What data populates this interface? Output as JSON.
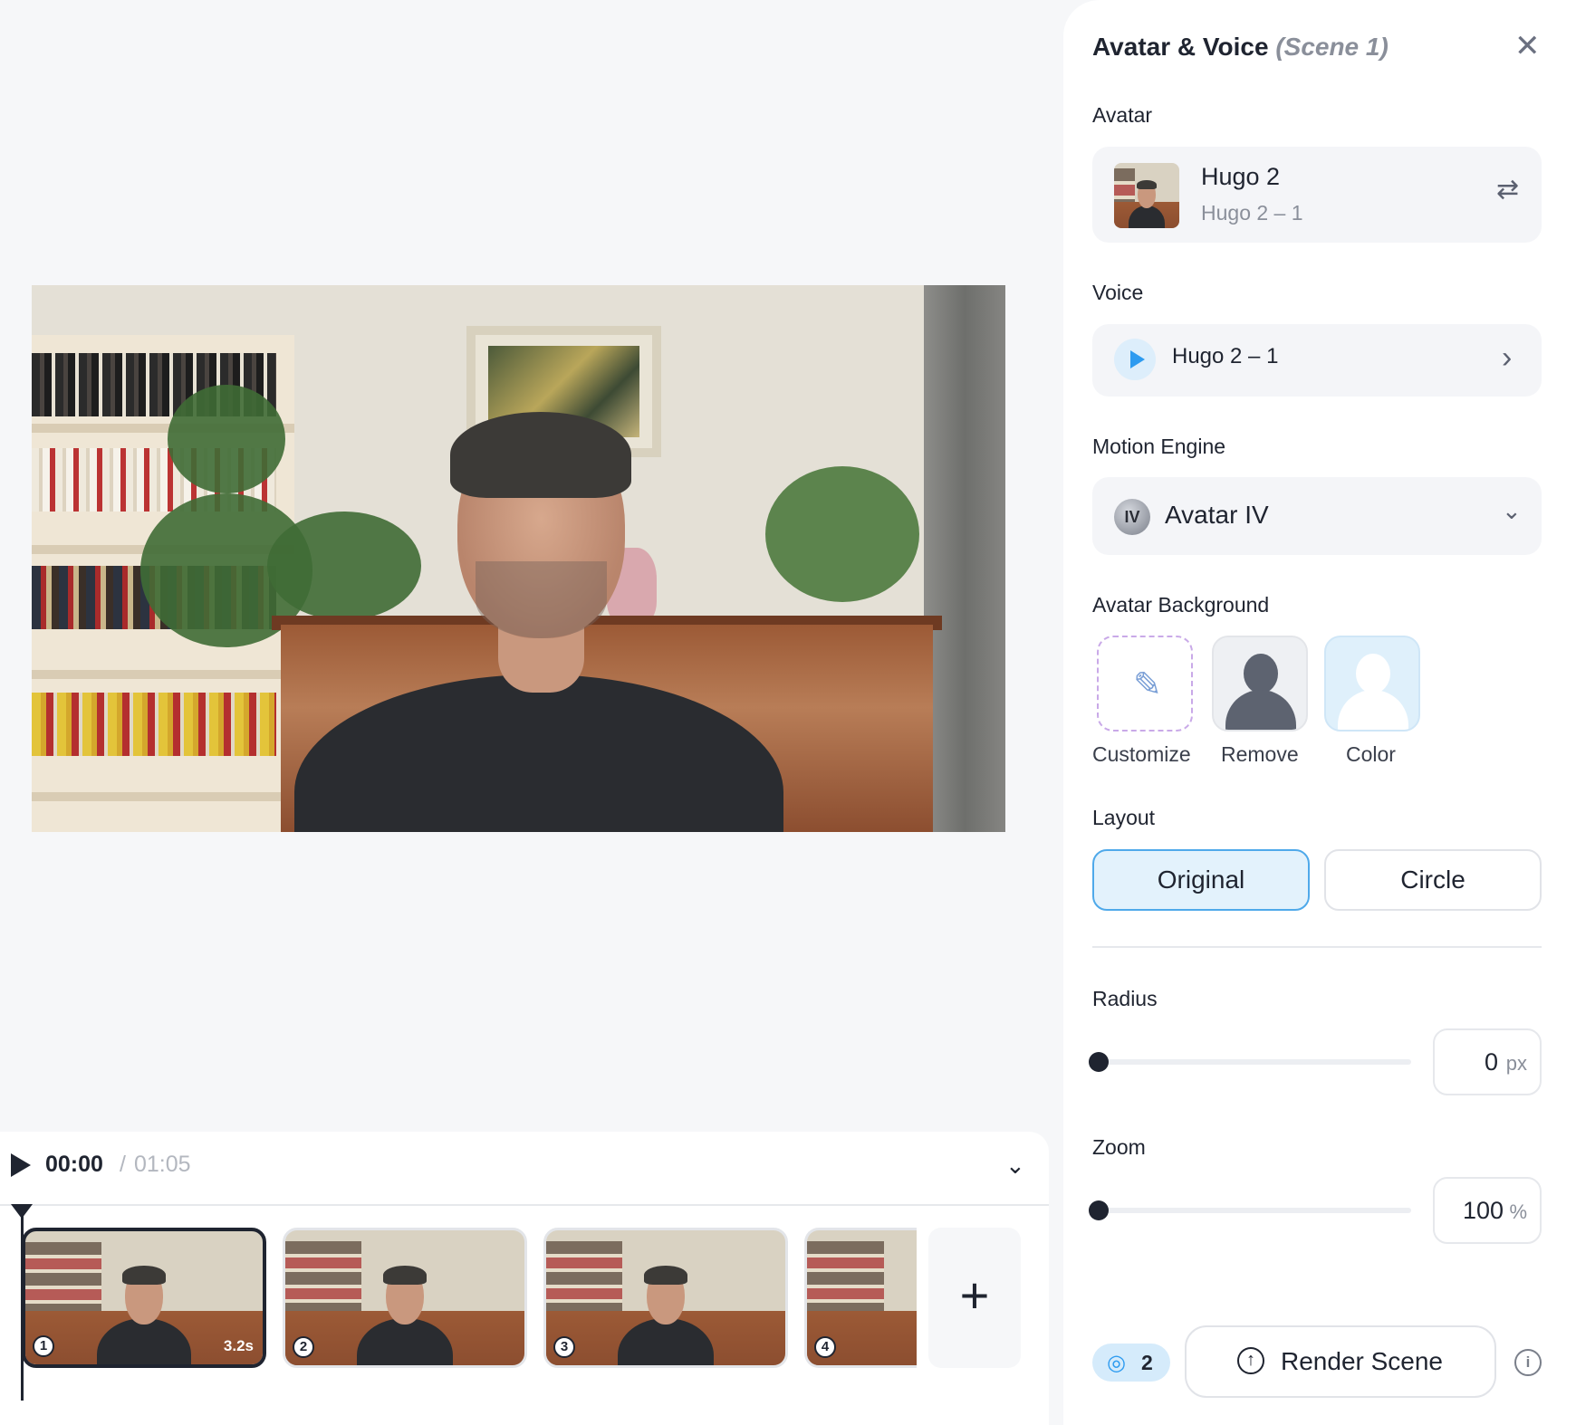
{
  "panel": {
    "title": "Avatar & Voice",
    "title_scene": "(Scene 1)",
    "close_icon": "✕",
    "avatar": {
      "label": "Avatar",
      "name": "Hugo 2",
      "look": "Hugo 2 – 1",
      "swap_icon": "⇄"
    },
    "voice": {
      "label": "Voice",
      "name": "Hugo 2 – 1",
      "chevron": "›"
    },
    "motion_engine": {
      "label": "Motion Engine",
      "badge": "IV",
      "name": "Avatar IV",
      "chevron": "⌄"
    },
    "avatar_background": {
      "label": "Avatar Background",
      "options": [
        {
          "label": "Customize",
          "icon": "magic-wand-icon"
        },
        {
          "label": "Remove",
          "icon": "person-silhouette-icon"
        },
        {
          "label": "Color",
          "icon": "person-silhouette-icon"
        }
      ]
    },
    "layout": {
      "label": "Layout",
      "options": [
        "Original",
        "Circle"
      ],
      "selected": "Original"
    },
    "radius": {
      "label": "Radius",
      "value": "0",
      "unit": "px",
      "level": 0
    },
    "zoom": {
      "label": "Zoom",
      "value": "100",
      "unit": "%",
      "level": 0
    },
    "footer": {
      "credits": "2",
      "render_label": "Render Scene",
      "info_icon": "i"
    }
  },
  "timeline": {
    "current_time": "00:00",
    "separator": "/",
    "total_time": "01:05",
    "collapse_icon": "⌄",
    "add_icon": "+",
    "scenes": [
      {
        "number": "1",
        "duration": "3.2s",
        "active": true
      },
      {
        "number": "2",
        "duration": "",
        "active": false
      },
      {
        "number": "3",
        "duration": "",
        "active": false
      },
      {
        "number": "4",
        "duration": "",
        "active": false
      }
    ]
  },
  "colors": {
    "accent": "#2d9bf0",
    "selected_bg": "#e3f2fc",
    "text": "#1f2430",
    "muted": "#8a8f9a"
  }
}
